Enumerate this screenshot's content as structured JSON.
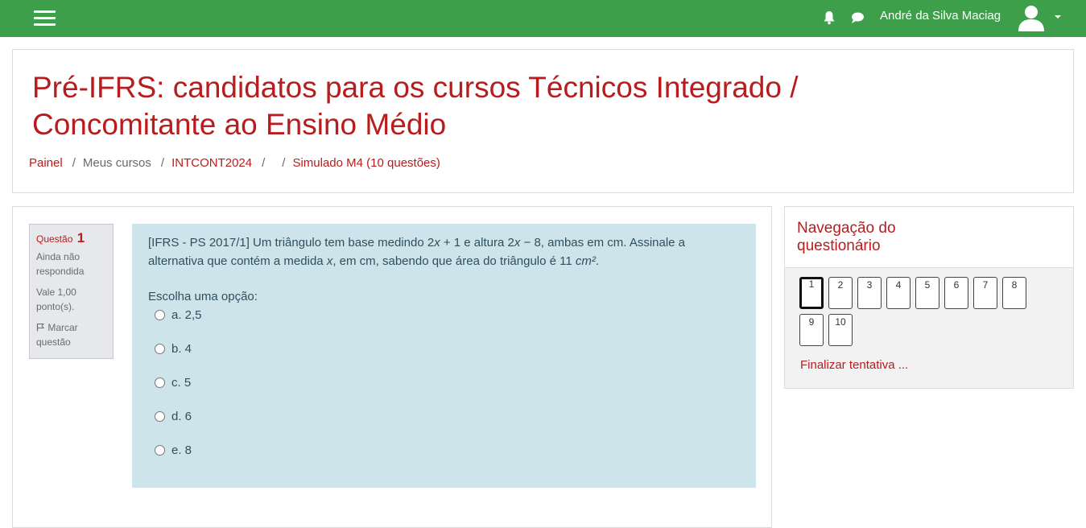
{
  "navbar": {
    "menu_icon": "hamburger-menu-icon",
    "notifications_icon": "bell-icon",
    "messages_icon": "chat-bubble-icon",
    "user_name": "André da Silva Maciag",
    "avatar_icon": "user-avatar-icon",
    "user_menu_icon": "caret-down-icon",
    "bar_color": "#3e9f4a"
  },
  "header": {
    "title": "Pré-IFRS: candidatos para os cursos Técnicos Integrado / Concomitante ao Ensino Médio",
    "breadcrumb": [
      "Painel",
      "Meus cursos",
      "INTCONT2024",
      "",
      "Simulado M4 (10 questões)"
    ]
  },
  "question": {
    "label": "Questão",
    "number": "1",
    "state": "Ainda não respondida",
    "grade": "Vale 1,00 ponto(s).",
    "flag_icon": "flag-icon",
    "flag_label": "Marcar questão",
    "text_part1": "[IFRS - PS 2017/1] Um triângulo tem base medindo 2",
    "text_var1": "x",
    "text_part2": " + 1 e altura 2",
    "text_var2": "x",
    "text_part3": " − 8, ambas em cm. Assinale a alternativa que contém a medida ",
    "text_var3": "x",
    "text_part4": ", em cm, sabendo que área do triângulo é 11 ",
    "text_unit": "cm²",
    "text_part5": ".",
    "prompt": "Escolha uma opção:",
    "options": [
      "a. 2,5",
      "b. 4",
      "c. 5",
      "d. 6",
      "e. 8"
    ]
  },
  "quiz_nav": {
    "title": "Navegação do questionário",
    "buttons": [
      "1",
      "2",
      "3",
      "4",
      "5",
      "6",
      "7",
      "8",
      "9",
      "10"
    ],
    "current": "1",
    "finish_label": "Finalizar tentativa ..."
  },
  "colors": {
    "accent": "#b81c1c",
    "question_bg": "#cde5ea"
  }
}
